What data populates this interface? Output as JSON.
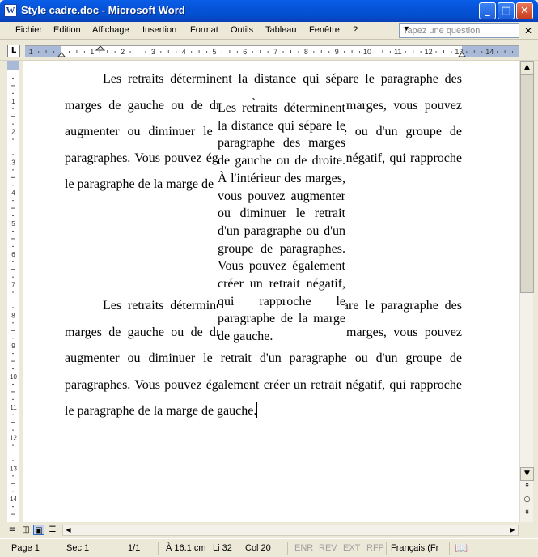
{
  "window": {
    "title": "Style cadre.doc - Microsoft Word",
    "icon_letter": "W"
  },
  "window_buttons": {
    "minimize": "_",
    "maximize": "□",
    "close": "✕"
  },
  "menu": [
    "Fichier",
    "Edition",
    "Affichage",
    "Insertion",
    "Format",
    "Outils",
    "Tableau",
    "Fenêtre",
    "?"
  ],
  "help": {
    "placeholder": "Tapez une question"
  },
  "ruler": {
    "tab_selector": "L",
    "numbers": [
      "1",
      "2",
      "1",
      "2",
      "3",
      "4",
      "5",
      "6",
      "7",
      "8",
      "9",
      "10",
      "11",
      "12",
      "13",
      "14",
      "15"
    ]
  },
  "vruler_numbers": [
    "1",
    "2",
    "3",
    "4",
    "5",
    "6",
    "7",
    "8",
    "9",
    "10",
    "11",
    "12",
    "13",
    "14",
    "15"
  ],
  "document": {
    "p1": "Les retraits déterminent la distance qui sépare le paragraphe des marges de gauche ou de droite. À l'intérieur des marges, vous pouvez augmenter ou diminuer le retrait d'un paragraphe ou d'un groupe de paragraphes. Vous pouvez également créer un retrait négatif, qui rapproche le paragraphe de la marge de gauche.",
    "frame": "Les retraits déterminent la distance qui sépare le paragraphe des marges de gauche ou de droite. À l'intérieur des marges, vous pouvez augmenter ou diminuer le retrait d'un paragraphe ou d'un groupe de paragraphes. Vous pouvez également créer un retrait négatif, qui rapproche le paragraphe de la marge de gauche.",
    "p2": "Les retraits déterminent la distance qui sépare le paragraphe des marges de gauche ou de droite. À l'intérieur des marges, vous pouvez augmenter ou diminuer le retrait d'un paragraphe ou d'un groupe de paragraphes. Vous pouvez également créer un retrait négatif, qui rapproche le paragraphe de la marge de gauche."
  },
  "status": {
    "page": "Page 1",
    "section": "Sec 1",
    "pages": "1/1",
    "position": "À 16.1 cm",
    "line": "Li 32",
    "col": "Col 20",
    "enr": "ENR",
    "rev": "REV",
    "ext": "EXT",
    "rfp": "RFP",
    "language": "Français (Fr"
  },
  "colors": {
    "title_bar": "#0653d8",
    "chrome": "#ece9d8",
    "ruler_margin": "#a9b9d8"
  }
}
